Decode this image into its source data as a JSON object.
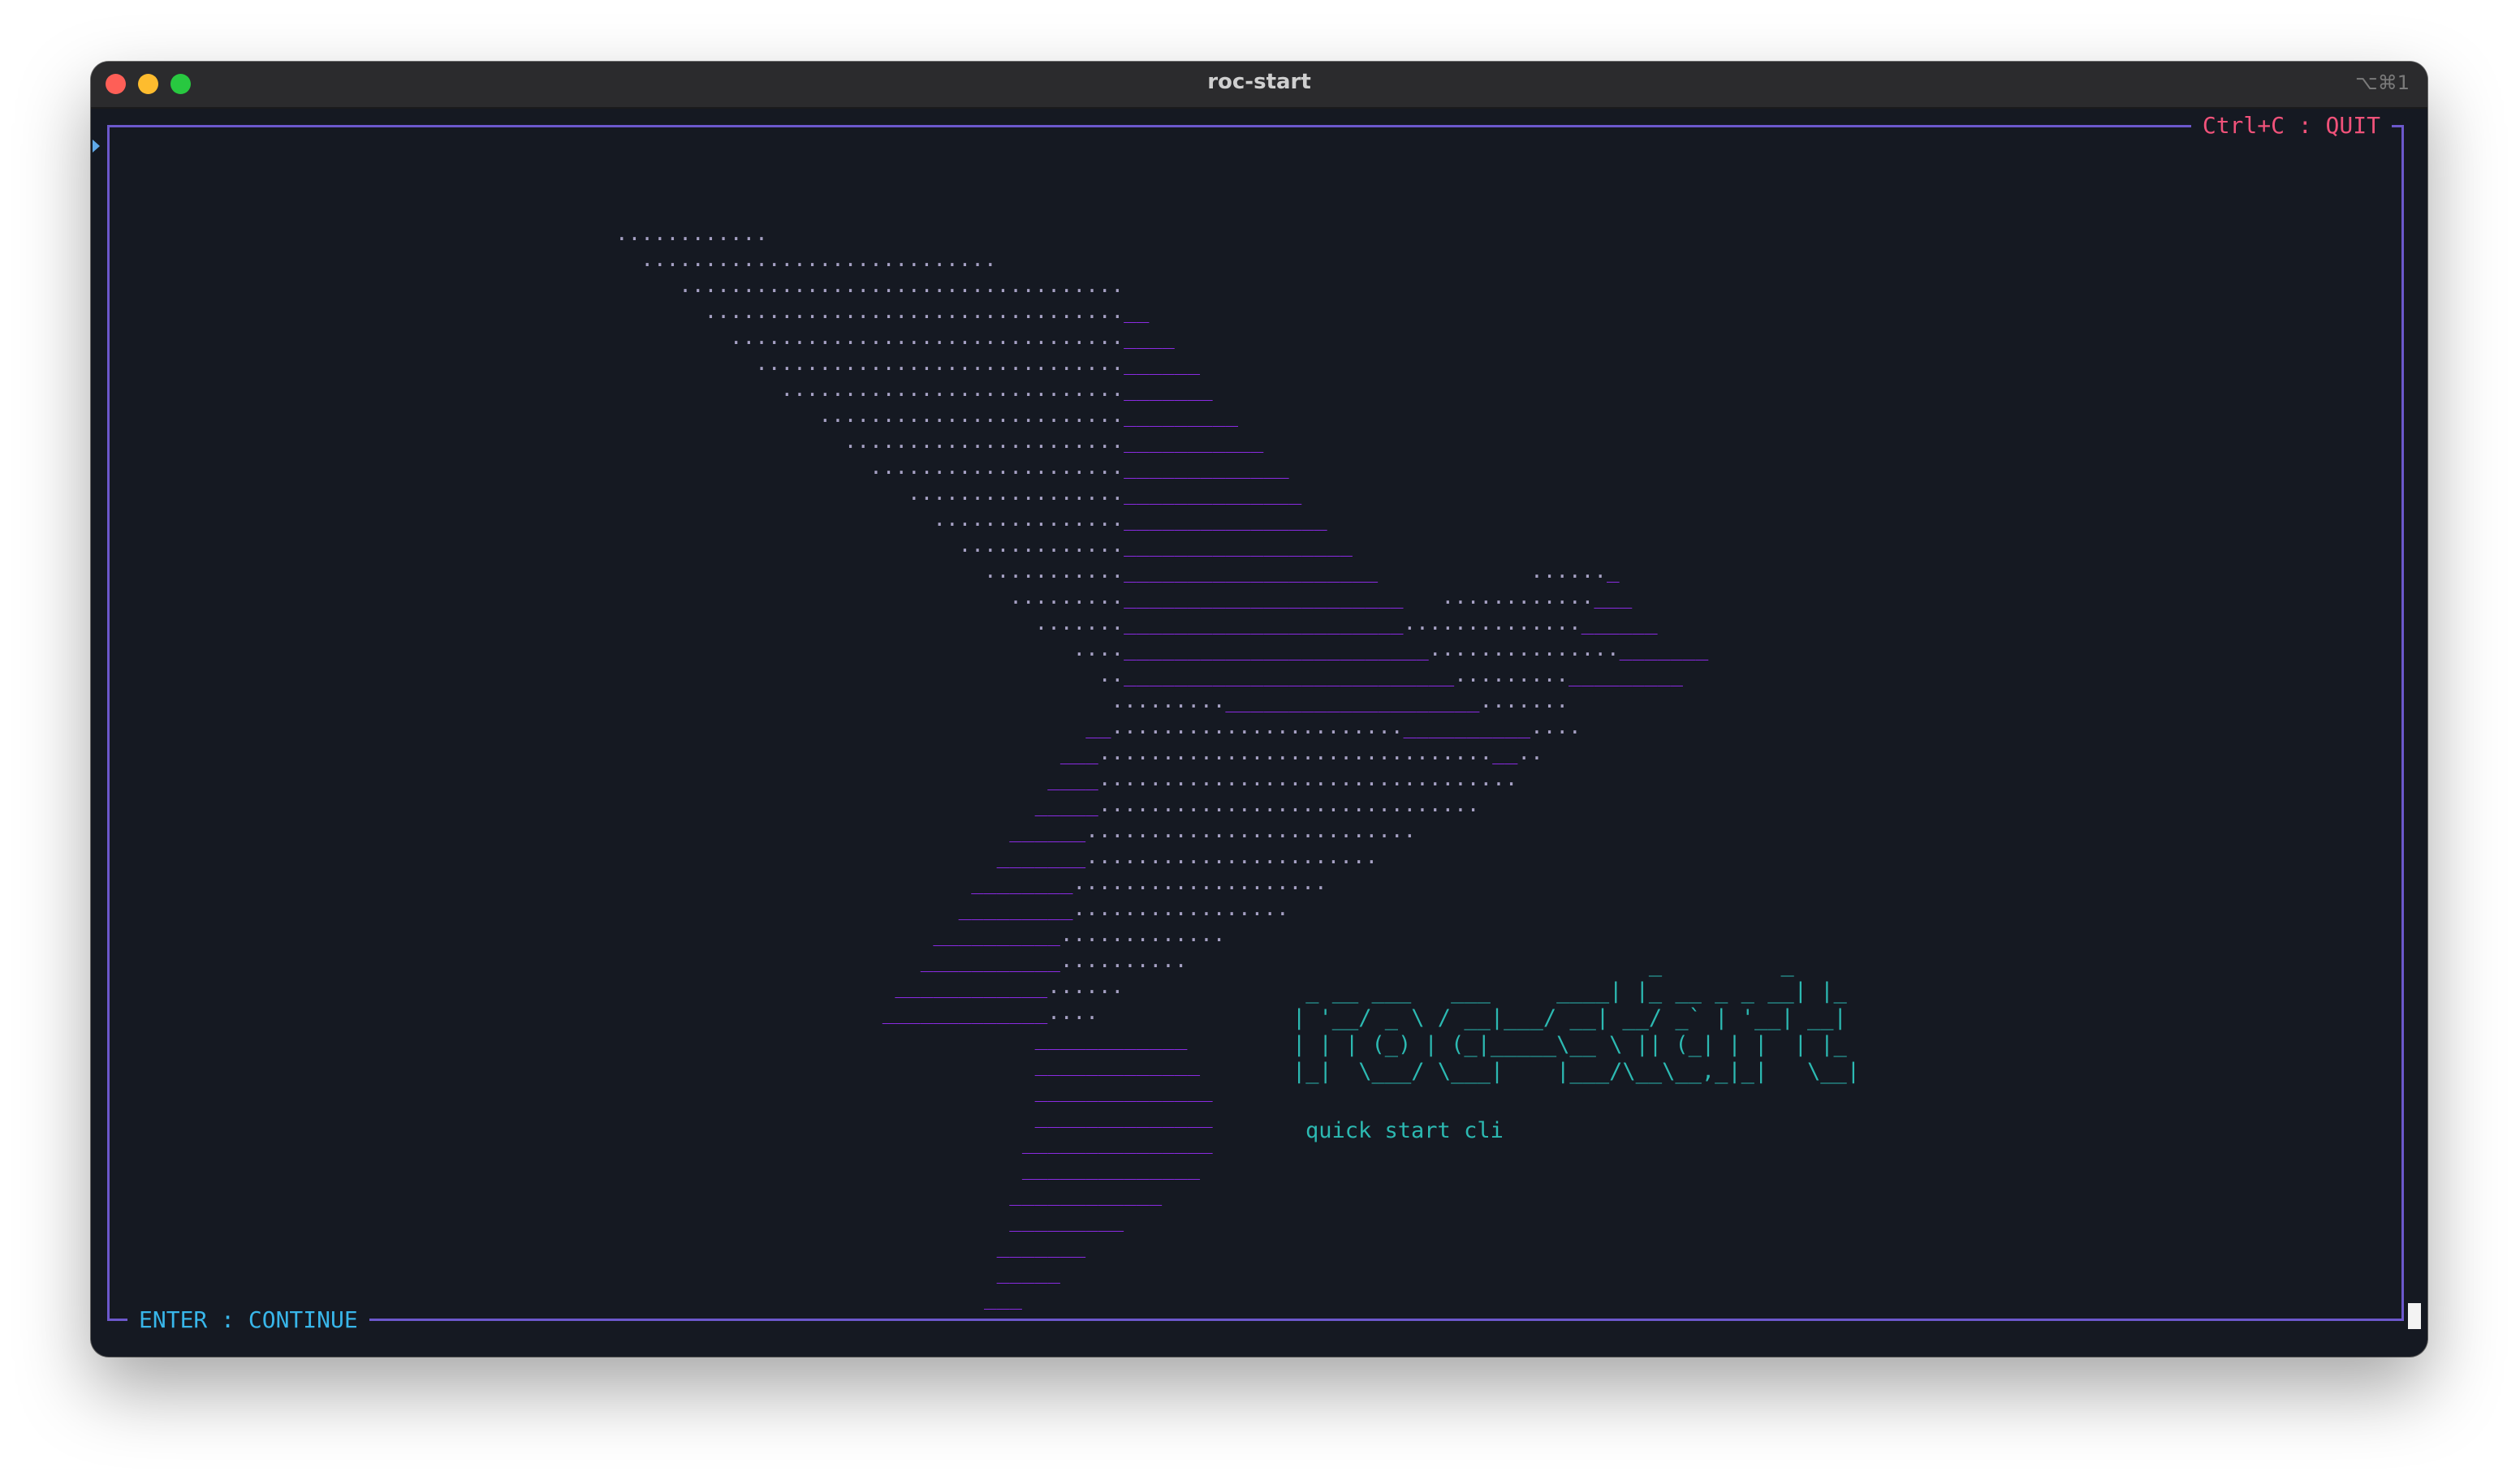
{
  "window": {
    "title": "roc-start",
    "shortcut": "⌥⌘1"
  },
  "frame": {
    "top_right_label": "Ctrl+C : QUIT",
    "bottom_left_label": "ENTER : CONTINUE"
  },
  "splash": {
    "logo_lines": [
      "                           _         _",
      " _ __ ___   ___     ____| |_ __ _ _ __| |_",
      "| '__/ _ \\ / __|___/ __| __/ _` | '__| __|",
      "| | | (_) | (_|_____\\__ \\ || (_| | |  | |_",
      "|_|  \\___/ \\___|    |___/\\__\\__,_|_|   \\__|"
    ],
    "tagline": "quick start cli"
  },
  "colors": {
    "background": "#151922",
    "frame_border": "#6c58cc",
    "quit_label": "#f0527a",
    "continue_label": "#38b6ea",
    "bird_dots": "#a6a1c4",
    "bird_dashes": "#8a2be2",
    "logo": "#2cb9b2"
  }
}
